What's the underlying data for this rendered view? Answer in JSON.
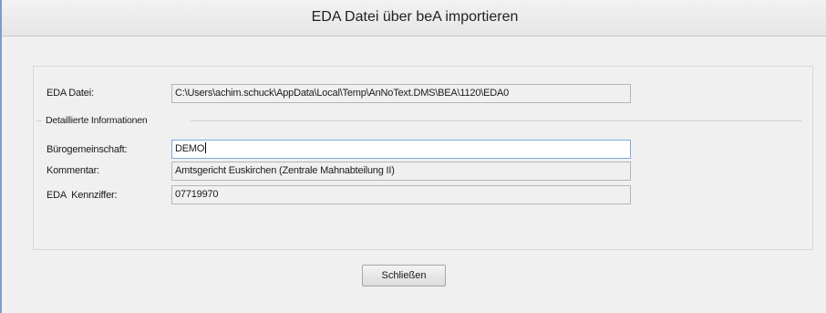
{
  "window": {
    "title": "EDA Datei über beA importieren"
  },
  "form": {
    "eda_datei_label": "EDA Datei:",
    "eda_datei_value": "C:\\Users\\achim.schuck\\AppData\\Local\\Temp\\AnNoText.DMS\\BEA\\1120\\EDA0",
    "group_label": "Detaillierte Informationen",
    "buerogemeinschaft_label": "Bürogemeinschaft:",
    "buerogemeinschaft_value": "DEMO",
    "kommentar_label": "Kommentar:",
    "kommentar_value": "Amtsgericht Euskirchen (Zentrale Mahnabteilung II)",
    "kennziffer_label": "EDA  Kennziffer:",
    "kennziffer_value": "07719970"
  },
  "buttons": {
    "close_label": "Schließen"
  },
  "colors": {
    "window_bg": "#f0f0f0",
    "active_field_border": "#7fa9e0",
    "window_border": "#7a9cc9"
  }
}
